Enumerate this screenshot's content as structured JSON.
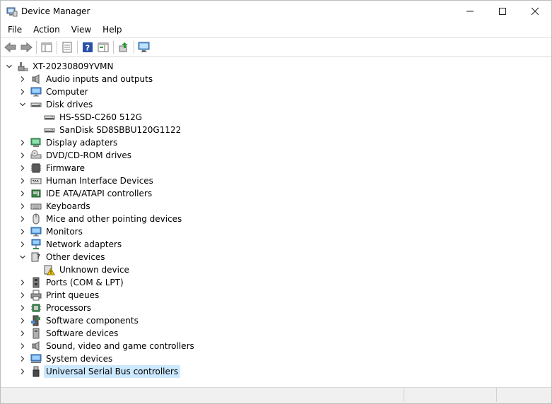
{
  "window": {
    "title": "Device Manager"
  },
  "menu": [
    {
      "id": "file",
      "label": "File"
    },
    {
      "id": "action",
      "label": "Action"
    },
    {
      "id": "view",
      "label": "View"
    },
    {
      "id": "help",
      "label": "Help"
    }
  ],
  "toolbar": {
    "back": "back-arrow-icon",
    "forward": "forward-arrow-icon",
    "show_hide_console_tree": "console-tree-icon",
    "properties": "properties-icon",
    "help": "help-icon",
    "action_pane": "action-pane-icon",
    "update_driver": "update-driver-icon",
    "scan_hardware": "monitor-scan-icon"
  },
  "tree": {
    "root": {
      "label": "XT-20230809YVMN"
    },
    "categories": [
      {
        "label": "Audio inputs and outputs",
        "icon": "speaker-icon"
      },
      {
        "label": "Computer",
        "icon": "computer-icon"
      },
      {
        "label": "Disk drives",
        "icon": "disk-icon",
        "expanded": true,
        "children": [
          {
            "label": "HS-SSD-C260 512G",
            "icon": "disk-icon"
          },
          {
            "label": "SanDisk SD8SBBU120G1122",
            "icon": "disk-icon"
          }
        ]
      },
      {
        "label": "Display adapters",
        "icon": "display-adapter-icon"
      },
      {
        "label": "DVD/CD-ROM drives",
        "icon": "dvd-icon"
      },
      {
        "label": "Firmware",
        "icon": "firmware-icon"
      },
      {
        "label": "Human Interface Devices",
        "icon": "hid-icon"
      },
      {
        "label": "IDE ATA/ATAPI controllers",
        "icon": "ide-icon"
      },
      {
        "label": "Keyboards",
        "icon": "keyboard-icon"
      },
      {
        "label": "Mice and other pointing devices",
        "icon": "mouse-icon"
      },
      {
        "label": "Monitors",
        "icon": "monitor-icon"
      },
      {
        "label": "Network adapters",
        "icon": "network-icon"
      },
      {
        "label": "Other devices",
        "icon": "other-devices-icon",
        "expanded": true,
        "children": [
          {
            "label": "Unknown device",
            "icon": "warning-device-icon"
          }
        ]
      },
      {
        "label": "Ports (COM & LPT)",
        "icon": "port-icon"
      },
      {
        "label": "Print queues",
        "icon": "printer-icon"
      },
      {
        "label": "Processors",
        "icon": "processor-icon"
      },
      {
        "label": "Software components",
        "icon": "software-component-icon"
      },
      {
        "label": "Software devices",
        "icon": "software-device-icon"
      },
      {
        "label": "Sound, video and game controllers",
        "icon": "sound-icon"
      },
      {
        "label": "System devices",
        "icon": "system-devices-icon"
      },
      {
        "label": "Universal Serial Bus controllers",
        "icon": "usb-icon",
        "selected": true
      }
    ]
  }
}
